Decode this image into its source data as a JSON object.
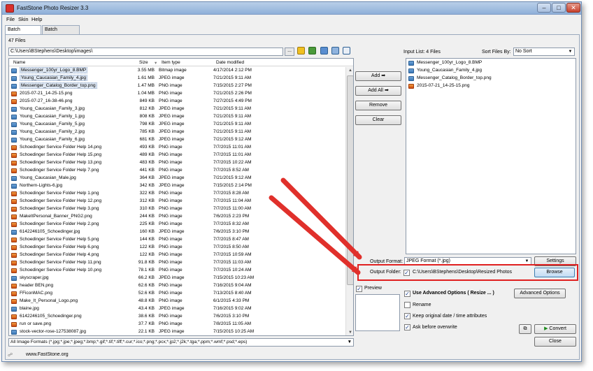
{
  "window": {
    "title": "FastStone Photo Resizer 3.3"
  },
  "menu": [
    "File",
    "Skin",
    "Help"
  ],
  "tabs": [
    "Batch Convert",
    "Batch Rename"
  ],
  "files_count": "47 Files",
  "path": "C:\\Users\\BStephens\\Desktop\\images\\",
  "path_browse": "...",
  "columns": {
    "name": "Name",
    "size": "Size",
    "type": "Item type",
    "date": "Date modified"
  },
  "files": [
    {
      "name": "Messenger_100yr_Logo_8.BMP",
      "size": "3.55 MB",
      "type": "Bitmap image",
      "date": "4/17/2014 2:12 PM",
      "kind": "img",
      "sel": true
    },
    {
      "name": "Young_Caucasian_Family_4.jpg",
      "size": "1.61 MB",
      "type": "JPEG image",
      "date": "7/21/2015 9:11 AM",
      "kind": "img",
      "sel": true
    },
    {
      "name": "Messenger_Catalog_Border_top.png",
      "size": "1.47 MB",
      "type": "PNG image",
      "date": "7/15/2015 2:27 PM",
      "kind": "img",
      "sel": true
    },
    {
      "name": "2015-07-21_14-25-15.png",
      "size": "1.04 MB",
      "type": "PNG image",
      "date": "7/21/2015 2:26 PM",
      "kind": "png",
      "sel": false
    },
    {
      "name": "2015-07-27_16-38-46.png",
      "size": "849 KB",
      "type": "PNG image",
      "date": "7/27/2015 4:49 PM",
      "kind": "png",
      "sel": false
    },
    {
      "name": "Young_Caucasian_Family_3.jpg",
      "size": "812 KB",
      "type": "JPEG image",
      "date": "7/21/2015 9:11 AM",
      "kind": "img",
      "sel": false
    },
    {
      "name": "Young_Caucasian_Family_1.jpg",
      "size": "808 KB",
      "type": "JPEG image",
      "date": "7/21/2015 9:11 AM",
      "kind": "img",
      "sel": false
    },
    {
      "name": "Young_Caucasian_Family_5.jpg",
      "size": "798 KB",
      "type": "JPEG image",
      "date": "7/21/2015 9:11 AM",
      "kind": "img",
      "sel": false
    },
    {
      "name": "Young_Caucasian_Family_2.jpg",
      "size": "785 KB",
      "type": "JPEG image",
      "date": "7/21/2015 9:11 AM",
      "kind": "img",
      "sel": false
    },
    {
      "name": "Young_Caucasian_Family_6.jpg",
      "size": "681 KB",
      "type": "JPEG image",
      "date": "7/21/2015 9:12 AM",
      "kind": "img",
      "sel": false
    },
    {
      "name": "Schoedinger Service Folder Help 14.png",
      "size": "493 KB",
      "type": "PNG image",
      "date": "7/7/2015 11:01 AM",
      "kind": "png",
      "sel": false
    },
    {
      "name": "Schoedinger Service Folder Help 15.png",
      "size": "489 KB",
      "type": "PNG image",
      "date": "7/7/2015 11:01 AM",
      "kind": "png",
      "sel": false
    },
    {
      "name": "Schoedinger Service Folder Help 13.png",
      "size": "483 KB",
      "type": "PNG image",
      "date": "7/7/2015 10:22 AM",
      "kind": "png",
      "sel": false
    },
    {
      "name": "Schoedinger Service Folder Help 7.png",
      "size": "441 KB",
      "type": "PNG image",
      "date": "7/7/2015 8:52 AM",
      "kind": "png",
      "sel": false
    },
    {
      "name": "Young_Caucasian_Male.jpg",
      "size": "364 KB",
      "type": "JPEG image",
      "date": "7/21/2015 9:12 AM",
      "kind": "img",
      "sel": false
    },
    {
      "name": "Northern-Lights-6.jpg",
      "size": "342 KB",
      "type": "JPEG image",
      "date": "7/15/2015 2:14 PM",
      "kind": "img",
      "sel": false
    },
    {
      "name": "Schoedinger Service Folder Help 1.png",
      "size": "322 KB",
      "type": "PNG image",
      "date": "7/7/2015 8:28 AM",
      "kind": "png",
      "sel": false
    },
    {
      "name": "Schoedinger Service Folder Help 12.png",
      "size": "312 KB",
      "type": "PNG image",
      "date": "7/7/2015 11:04 AM",
      "kind": "png",
      "sel": false
    },
    {
      "name": "Schoedinger Service Folder Help 3.png",
      "size": "310 KB",
      "type": "PNG image",
      "date": "7/7/2015 11:00 AM",
      "kind": "png",
      "sel": false
    },
    {
      "name": "MakeItPersonal_Banner_PNG2.png",
      "size": "244 KB",
      "type": "PNG image",
      "date": "7/6/2015 2:23 PM",
      "kind": "png",
      "sel": false
    },
    {
      "name": "Schoedinger Service Folder Help 2.png",
      "size": "225 KB",
      "type": "PNG image",
      "date": "7/7/2015 8:32 AM",
      "kind": "png",
      "sel": false
    },
    {
      "name": "6142246105_Schoedinger.jpg",
      "size": "160 KB",
      "type": "JPEG image",
      "date": "7/6/2015 3:10 PM",
      "kind": "img",
      "sel": false
    },
    {
      "name": "Schoedinger Service Folder Help 5.png",
      "size": "144 KB",
      "type": "PNG image",
      "date": "7/7/2015 8:47 AM",
      "kind": "png",
      "sel": false
    },
    {
      "name": "Schoedinger Service Folder Help 6.png",
      "size": "122 KB",
      "type": "PNG image",
      "date": "7/7/2015 8:50 AM",
      "kind": "png",
      "sel": false
    },
    {
      "name": "Schoedinger Service Folder Help 4.png",
      "size": "122 KB",
      "type": "PNG image",
      "date": "7/7/2015 10:59 AM",
      "kind": "png",
      "sel": false
    },
    {
      "name": "Schoedinger Service Folder Help 11.png",
      "size": "91.8 KB",
      "type": "PNG image",
      "date": "7/7/2015 11:03 AM",
      "kind": "png",
      "sel": false
    },
    {
      "name": "Schoedinger Service Folder Help 10.png",
      "size": "78.1 KB",
      "type": "PNG image",
      "date": "7/7/2015 10:24 AM",
      "kind": "png",
      "sel": false
    },
    {
      "name": "skyscraper.jpg",
      "size": "66.2 KB",
      "type": "JPEG image",
      "date": "7/15/2015 10:23 AM",
      "kind": "img",
      "sel": false
    },
    {
      "name": "header BEN.png",
      "size": "62.6 KB",
      "type": "PNG image",
      "date": "7/16/2015 9:04 AM",
      "kind": "png",
      "sel": false
    },
    {
      "name": "FFiconMAC.png",
      "size": "52.6 KB",
      "type": "PNG image",
      "date": "7/13/2015 8:40 AM",
      "kind": "png",
      "sel": false
    },
    {
      "name": "Make_It_Personal_Logo.png",
      "size": "48.8 KB",
      "type": "PNG image",
      "date": "6/1/2015 4:33 PM",
      "kind": "png",
      "sel": false
    },
    {
      "name": "blaine.jpg",
      "size": "43.4 KB",
      "type": "JPEG image",
      "date": "7/16/2015 9:02 AM",
      "kind": "img",
      "sel": false
    },
    {
      "name": "6142246105_Schoedinger.png",
      "size": "38.6 KB",
      "type": "PNG image",
      "date": "7/6/2015 3:10 PM",
      "kind": "png",
      "sel": false
    },
    {
      "name": "run or save.png",
      "size": "37.7 KB",
      "type": "PNG image",
      "date": "7/8/2015 11:05 AM",
      "kind": "png",
      "sel": false
    },
    {
      "name": "stock-vector-rose-127538087.jpg",
      "size": "22.1 KB",
      "type": "JPEG image",
      "date": "7/15/2015 10:25 AM",
      "kind": "img",
      "sel": false
    }
  ],
  "actions": {
    "add": "Add",
    "add_all": "Add All",
    "remove": "Remove",
    "clear": "Clear"
  },
  "input_list": {
    "label": "Input List: 4 Files",
    "sort_label": "Sort Files By:",
    "sort_value": "No Sort",
    "items": [
      "Messenger_100yr_Logo_8.BMP",
      "Young_Caucasian_Family_4.jpg",
      "Messenger_Catalog_Border_top.png",
      "2015-07-21_14-25-15.png"
    ]
  },
  "output": {
    "format_label": "Output Format:",
    "format_value": "JPEG Format (*.jpg)",
    "settings": "Settings",
    "folder_label": "Output Folder:",
    "folder_value": "C:\\Users\\BStephens\\Desktop\\Resized Photos",
    "browse": "Browse"
  },
  "preview_label": "Preview",
  "options": {
    "advanced": "Use Advanced Options ( Resize ... )",
    "advanced_btn": "Advanced Options",
    "rename": "Rename",
    "keep_date": "Keep original date / time attributes",
    "ask_overwrite": "Ask before overwrite"
  },
  "buttons": {
    "convert": "Convert",
    "close": "Close"
  },
  "format_filter": "All Image Formats (*.jpg;*.jpe;*.jpeg;*.bmp;*.gif;*.tif;*.tiff;*.cur;*.ico;*.png;*.pcx;*.jp2;*.j2k;*.tga;*.ppm;*.wmf;*.psd;*.eps)",
  "status": "www.FastStone.org",
  "colors": {
    "highlight": "#e02020",
    "arrow": "#e0302b"
  }
}
